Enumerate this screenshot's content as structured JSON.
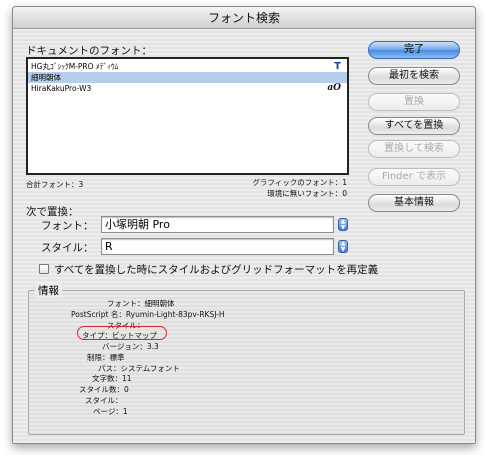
{
  "window": {
    "title": "フォント検索"
  },
  "document_fonts": {
    "label": "ドキュメントのフォント：",
    "rows": [
      {
        "name": "HG丸ｺﾞｼｯｸM-PRO ﾒﾃﾞｨｳﾑ",
        "icon": "T",
        "selected": false
      },
      {
        "name": "細明朝体",
        "icon": "",
        "selected": true
      },
      {
        "name": "HiraKakuPro-W3",
        "icon": "aO",
        "selected": false
      }
    ]
  },
  "counts": {
    "total_fonts": "合計フォント：3",
    "graphic_fonts": "グラフィックのフォント：1",
    "missing_fonts": "環境に無いフォント：0"
  },
  "replace": {
    "heading": "次で置換：",
    "font_label": "フォント：",
    "font_value": "小塚明朝 Pro",
    "style_label": "スタイル：",
    "style_value": "R",
    "redefine_checkbox_label": "すべてを置換した時にスタイルおよびグリッドフォーマットを再定義"
  },
  "buttons": {
    "done": "完了",
    "find_first": "最初を検索",
    "replace": "置換",
    "replace_all": "すべてを置換",
    "replace_find": "置換して検索",
    "reveal_finder": "Finder で表示",
    "basic_info": "基本情報"
  },
  "info": {
    "legend": "情報",
    "lines": [
      "フォント：細明朝体",
      "PostScript 名：Ryumin-Light-83pv-RKSJ-H",
      "スタイル：",
      "タイプ：ビットマップ",
      "バージョン：3.3",
      "制限：標準",
      "パス：システムフォント",
      "文字数：11",
      "スタイル数：0",
      "スタイル：",
      "ページ：1"
    ]
  },
  "colors": {
    "accent": "#4a8ae0",
    "selection": "#b6cdee",
    "callout": "#d8272b"
  }
}
